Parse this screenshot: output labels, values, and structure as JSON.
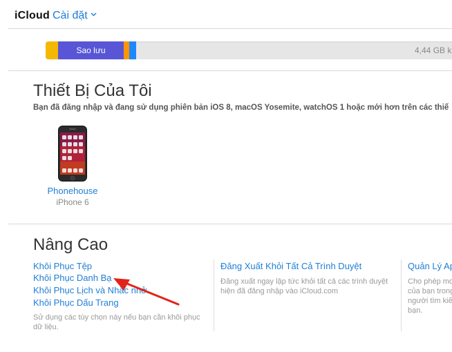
{
  "header": {
    "brand": "iCloud",
    "menu_label": "Cài đặt"
  },
  "storage": {
    "backup_label": "Sao lưu",
    "summary": "4,44 GB k",
    "segments": [
      {
        "name": "segment-1",
        "color": "#f5b800"
      },
      {
        "name": "backup",
        "color": "#5856d6"
      },
      {
        "name": "segment-3",
        "color": "#ff9500"
      },
      {
        "name": "segment-4",
        "color": "#1e88ff"
      }
    ]
  },
  "devices_section": {
    "title": "Thiết Bị Của Tôi",
    "description": "Bạn đã đăng nhập và đang sử dụng phiên bản iOS 8, macOS Yosemite, watchOS 1 hoặc mới hơn trên các thiế",
    "devices": [
      {
        "name": "Phonehouse",
        "model": "iPhone 6"
      }
    ]
  },
  "advanced_section": {
    "title": "Nâng Cao",
    "restore_links": [
      "Khôi Phục Tệp",
      "Khôi Phục Danh Bạ",
      "Khôi Phục Lịch và Nhắc nhở",
      "Khôi Phục Dấu Trang"
    ],
    "restore_note_line1": "Sử dụng các tùy chọn này nếu bạn cần khôi phục",
    "restore_note_line2": "dữ liệu.",
    "signout_link": "Đăng Xuất Khỏi Tất Cả Trình Duyệt",
    "signout_note_line1": "Đăng xuất ngay lập tức khỏi tất cả các trình duyệt",
    "signout_note_line2": "hiện đã đăng nhập vào iCloud.com",
    "manage_link": "Quản Lý Ap",
    "manage_note_line1": "Cho phép mo",
    "manage_note_line2": "của bạn trong",
    "manage_note_line3": "người tìm kiế",
    "manage_note_line4": "bạn."
  },
  "annotation": {
    "arrow_color": "#e0241b"
  }
}
